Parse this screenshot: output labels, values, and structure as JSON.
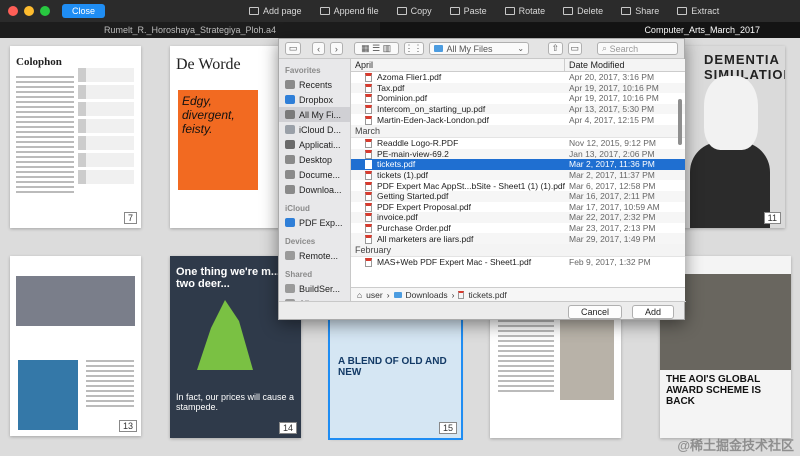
{
  "toolbar": {
    "close_label": "Close",
    "tools": [
      {
        "label": "Add page",
        "icon": "add-page-icon"
      },
      {
        "label": "Append file",
        "icon": "append-file-icon"
      },
      {
        "label": "Copy",
        "icon": "copy-icon"
      },
      {
        "label": "Paste",
        "icon": "paste-icon"
      },
      {
        "label": "Rotate",
        "icon": "rotate-icon"
      },
      {
        "label": "Delete",
        "icon": "delete-icon"
      },
      {
        "label": "Share",
        "icon": "share-icon"
      },
      {
        "label": "Extract",
        "icon": "extract-icon"
      }
    ],
    "traffic_colors": [
      "#ff5f57",
      "#febc2e",
      "#28c840"
    ]
  },
  "tabs": [
    {
      "label": "Rumelt_R._Horoshaya_Strategiya_Ploh.a4"
    },
    {
      "label": "Computer_Arts_March_2017"
    }
  ],
  "thumbnails": {
    "t1": {
      "heading": "Colophon",
      "page": "7"
    },
    "t2": {
      "heading": "De Worde",
      "subtitle": "Edgy, divergent, feisty.",
      "page": ""
    },
    "t3": {
      "heading": "DEMENTIA SIMULATION",
      "page": "11"
    },
    "t4": {
      "page": "13"
    },
    "t5": {
      "heading": "One thing we're m... is two deer...",
      "footer": "In fact, our prices will cause a stampede.",
      "page": "14"
    },
    "t6": {
      "heading": "A BLEND OF OLD AND NEW",
      "page": "15"
    },
    "t7": {
      "page": ""
    },
    "t8": {
      "heading": "THE AOI'S GLOBAL AWARD SCHEME IS BACK",
      "page": ""
    }
  },
  "dialog": {
    "location": "All My Files",
    "search_placeholder": "Search",
    "sidebar": {
      "favorites_label": "Favorites",
      "favorites": [
        {
          "label": "Recents",
          "icon": "recents-icon",
          "color": "#8a8a8a"
        },
        {
          "label": "Dropbox",
          "icon": "dropbox-icon",
          "color": "#2f7fd8"
        },
        {
          "label": "All My Fi...",
          "icon": "all-files-icon",
          "color": "#7a7a7a",
          "selected": true
        },
        {
          "label": "iCloud D...",
          "icon": "icloud-drive-icon",
          "color": "#9aa0a8"
        },
        {
          "label": "Applicati...",
          "icon": "applications-icon",
          "color": "#6a6a6a"
        },
        {
          "label": "Desktop",
          "icon": "desktop-icon",
          "color": "#8a8a8a"
        },
        {
          "label": "Docume...",
          "icon": "documents-icon",
          "color": "#8a8a8a"
        },
        {
          "label": "Downloa...",
          "icon": "downloads-icon",
          "color": "#8a8a8a"
        }
      ],
      "icloud_label": "iCloud",
      "icloud": [
        {
          "label": "PDF Exp...",
          "icon": "pdf-expert-icon",
          "color": "#2f7fd8"
        }
      ],
      "devices_label": "Devices",
      "devices": [
        {
          "label": "Remote...",
          "icon": "remote-disc-icon",
          "color": "#9a9a9a"
        }
      ],
      "shared_label": "Shared",
      "shared": [
        {
          "label": "BuildSer...",
          "icon": "server-icon",
          "color": "#9a9a9a"
        },
        {
          "label": "All...",
          "icon": "network-icon",
          "color": "#9a9a9a"
        }
      ]
    },
    "columns": {
      "name": "April",
      "date": "Date Modified"
    },
    "groups": [
      {
        "label": "",
        "files": [
          {
            "name": "Azoma Flier1.pdf",
            "date": "Apr 20, 2017, 3:16 PM"
          },
          {
            "name": "Tax.pdf",
            "date": "Apr 19, 2017, 10:16 PM"
          },
          {
            "name": "Dominion.pdf",
            "date": "Apr 19, 2017, 10:16 PM"
          },
          {
            "name": "Intercom_on_starting_up.pdf",
            "date": "Apr 13, 2017, 5:30 PM"
          },
          {
            "name": "Martin-Eden-Jack-London.pdf",
            "date": "Apr 4, 2017, 12:15 PM"
          }
        ]
      },
      {
        "label": "March",
        "files": [
          {
            "name": "Readdle Logo-R.PDF",
            "date": "Nov 12, 2015, 9:12 PM"
          },
          {
            "name": "PE-main-view-69.2",
            "date": "Jan 13, 2017, 2:06 PM"
          },
          {
            "name": "tickets.pdf",
            "date": "Mar 2, 2017, 11:36 PM",
            "selected": true
          },
          {
            "name": "tickets (1).pdf",
            "date": "Mar 2, 2017, 11:37 PM"
          },
          {
            "name": "PDF Expert Mac AppSt...bSite - Sheet1 (1) (1).pdf",
            "date": "Mar 6, 2017, 12:58 PM"
          },
          {
            "name": "Getting Started.pdf",
            "date": "Mar 16, 2017, 2:11 PM"
          },
          {
            "name": "PDF Expert Proposal.pdf",
            "date": "Mar 17, 2017, 10:59 AM"
          },
          {
            "name": "invoice.pdf",
            "date": "Mar 22, 2017, 2:32 PM"
          },
          {
            "name": "Purchase Order.pdf",
            "date": "Mar 23, 2017, 2:13 PM"
          },
          {
            "name": "All marketers are liars.pdf",
            "date": "Mar 29, 2017, 1:49 PM"
          }
        ]
      },
      {
        "label": "February",
        "files": [
          {
            "name": "MAS+Web PDF Expert Mac - Sheet1.pdf",
            "date": "Feb 9, 2017, 1:32 PM"
          }
        ]
      }
    ],
    "path": [
      "user",
      "Downloads",
      "tickets.pdf"
    ],
    "cancel_label": "Cancel",
    "add_label": "Add"
  },
  "watermark": "@稀土掘金技术社区"
}
